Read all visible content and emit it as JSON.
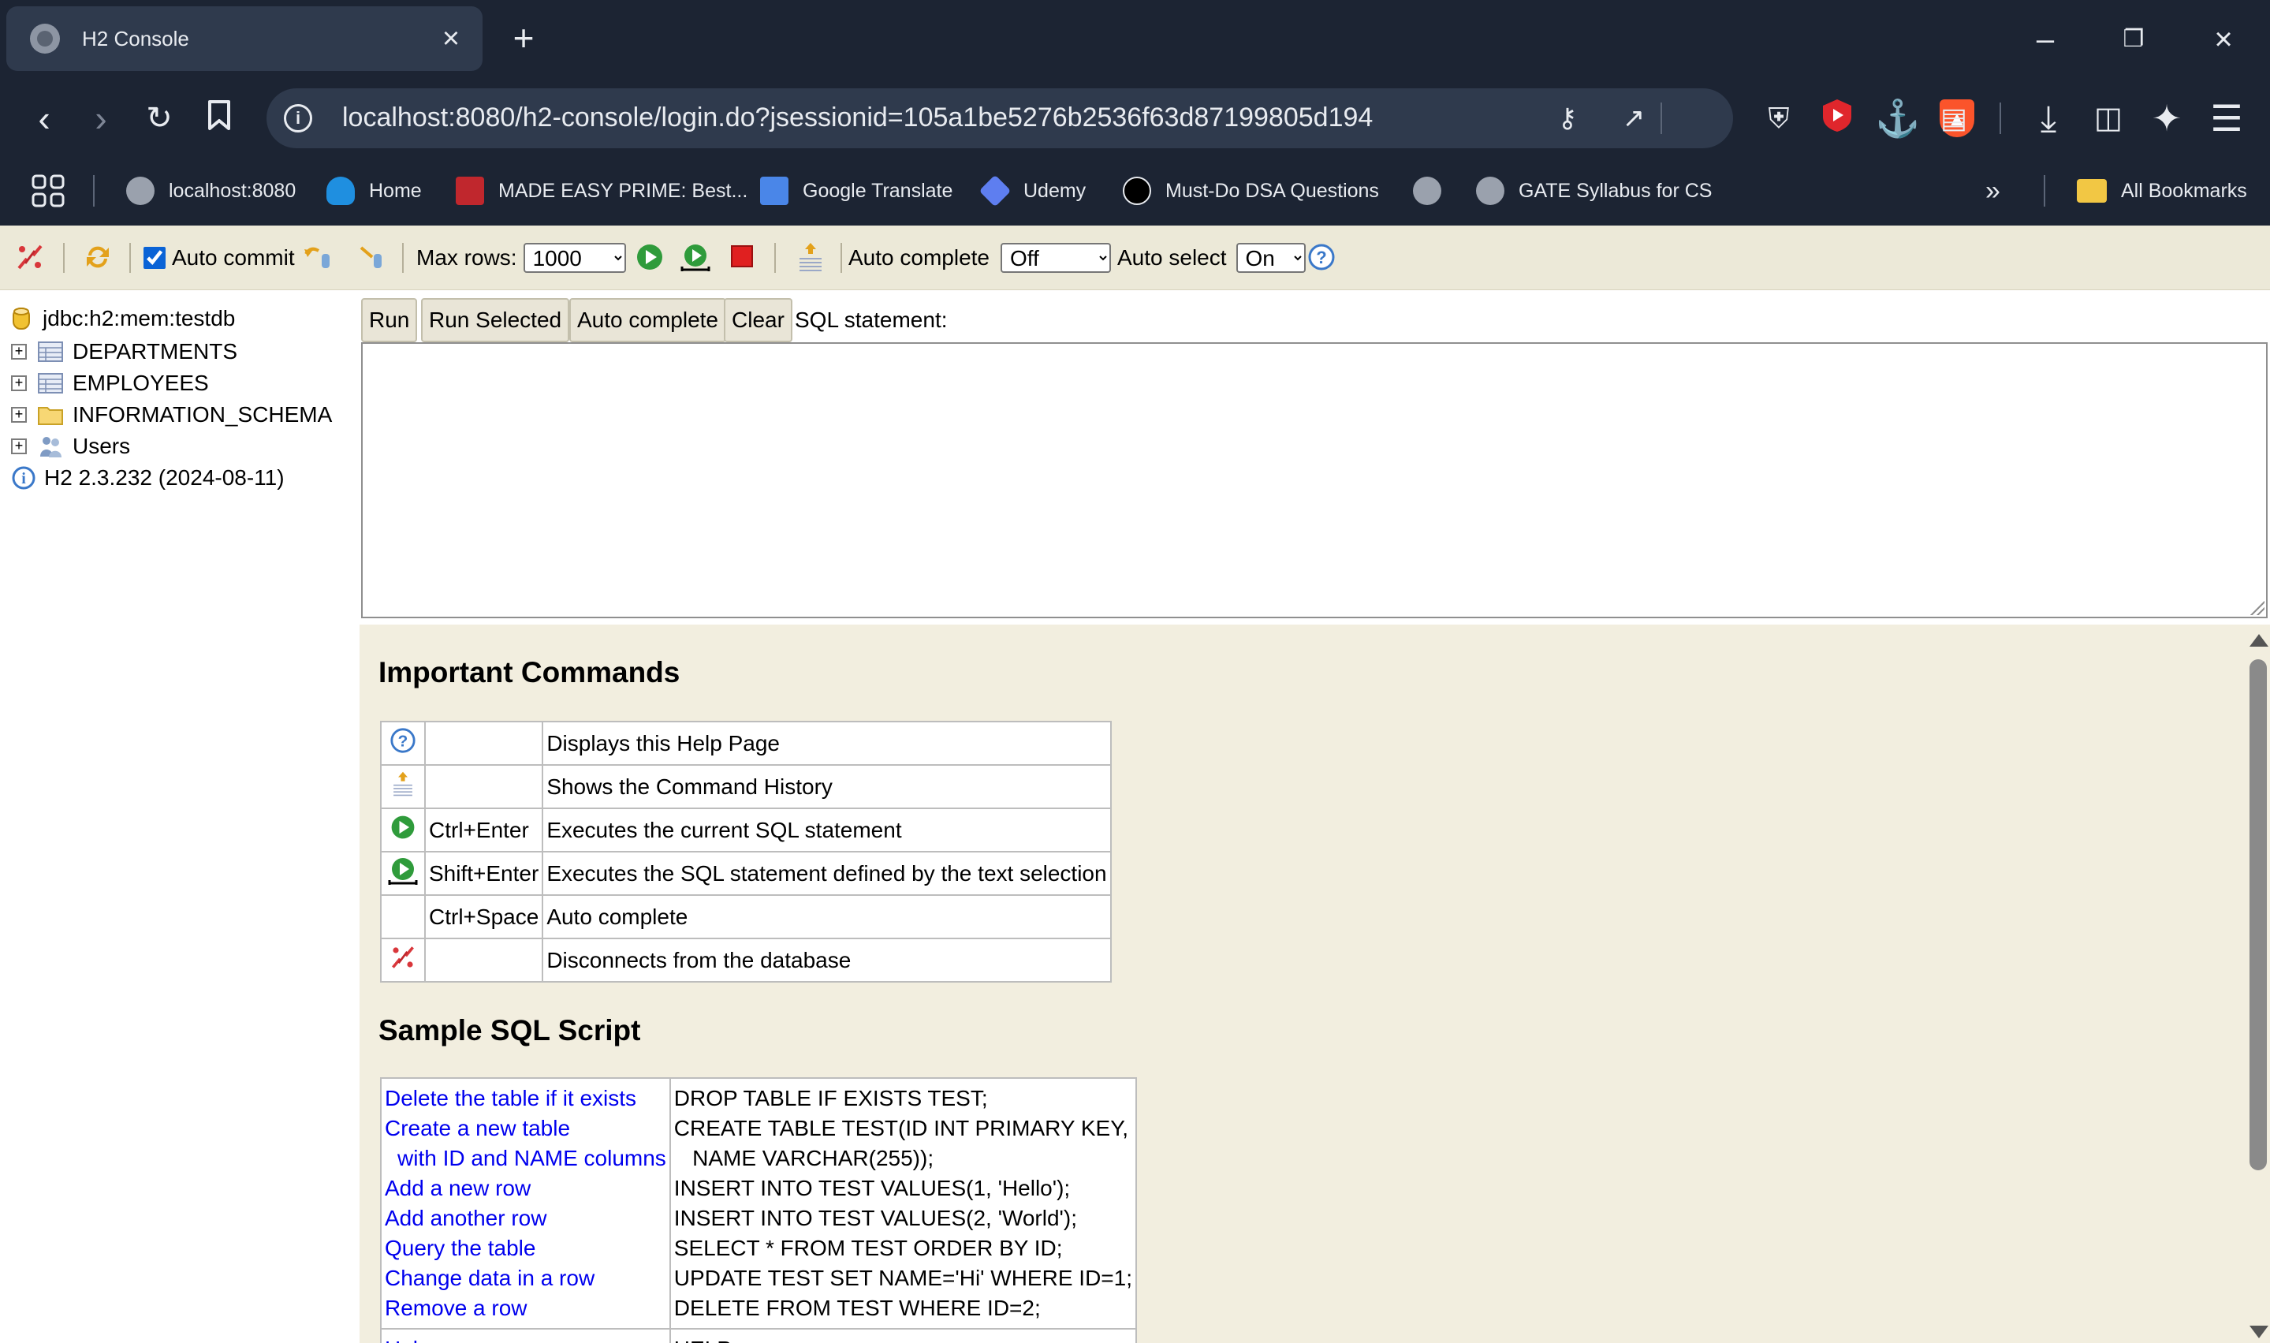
{
  "browser": {
    "tab_title": "H2 Console",
    "url": "localhost:8080/h2-console/login.do?jsessionid=105a1be5276b2536f63d87199805d194",
    "bookmarks": [
      {
        "label": "localhost:8080",
        "icon": "globe-icon"
      },
      {
        "label": "Home",
        "icon": "cloud-icon"
      },
      {
        "label": "MADE EASY PRIME: Best...",
        "icon": "made-easy-icon"
      },
      {
        "label": "Google Translate",
        "icon": "translate-icon"
      },
      {
        "label": "Udemy",
        "icon": "udemy-icon"
      },
      {
        "label": "Must-Do DSA Questions",
        "icon": "tuf-icon"
      },
      {
        "label": "",
        "icon": "globe-icon"
      },
      {
        "label": "GATE Syllabus for CS",
        "icon": "globe-icon"
      }
    ],
    "all_bookmarks_label": "All Bookmarks",
    "brave_color": "#fb542b"
  },
  "toolbar": {
    "auto_commit_label": "Auto commit",
    "auto_commit_checked": true,
    "max_rows_label": "Max rows:",
    "max_rows_value": "1000",
    "auto_complete_label": "Auto complete",
    "auto_complete_value": "Off",
    "auto_select_label": "Auto select",
    "auto_select_value": "On"
  },
  "tree": {
    "connection": "jdbc:h2:mem:testdb",
    "nodes": [
      {
        "label": "DEPARTMENTS",
        "icon": "table-icon"
      },
      {
        "label": "EMPLOYEES",
        "icon": "table-icon"
      },
      {
        "label": "INFORMATION_SCHEMA",
        "icon": "folder-icon"
      },
      {
        "label": "Users",
        "icon": "users-icon"
      }
    ],
    "version": "H2 2.3.232 (2024-08-11)"
  },
  "query": {
    "run_label": "Run",
    "run_selected_label": "Run Selected",
    "auto_complete_label": "Auto complete",
    "clear_label": "Clear",
    "sql_label": "SQL statement:",
    "sql_text": ""
  },
  "help": {
    "important_title": "Important Commands",
    "commands": [
      {
        "icon": "help-icon",
        "shortcut": "",
        "description": "Displays this Help Page"
      },
      {
        "icon": "history-icon",
        "shortcut": "",
        "description": "Shows the Command History"
      },
      {
        "icon": "run-icon",
        "shortcut": "Ctrl+Enter",
        "description": "Executes the current SQL statement"
      },
      {
        "icon": "run-selected-icon",
        "shortcut": "Shift+Enter",
        "description": "Executes the SQL statement defined by the text selection"
      },
      {
        "icon": "",
        "shortcut": "Ctrl+Space",
        "description": "Auto complete"
      },
      {
        "icon": "disconnect-icon",
        "shortcut": "",
        "description": "Disconnects from the database"
      }
    ],
    "sample_title": "Sample SQL Script",
    "sample_links": [
      "Delete the table if it exists",
      "Create a new table",
      "with ID and NAME columns",
      "Add a new row",
      "Add another row",
      "Query the table",
      "Change data in a row",
      "Remove a row"
    ],
    "sample_sql": [
      "DROP TABLE IF EXISTS TEST;",
      "CREATE TABLE TEST(ID INT PRIMARY KEY,",
      "   NAME VARCHAR(255));",
      "INSERT INTO TEST VALUES(1, 'Hello');",
      "INSERT INTO TEST VALUES(2, 'World');",
      "SELECT * FROM TEST ORDER BY ID;",
      "UPDATE TEST SET NAME='Hi' WHERE ID=1;",
      "DELETE FROM TEST WHERE ID=2;"
    ],
    "next_link": "Help",
    "next_sql": "HELP"
  }
}
